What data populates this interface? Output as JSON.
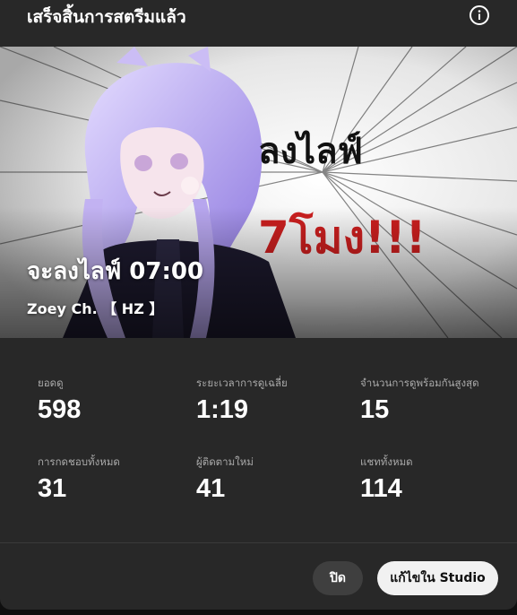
{
  "dialog": {
    "title": "เสร็จสิ้นการสตรีมแล้ว",
    "info_icon": "info-icon"
  },
  "thumbnail": {
    "title": "จะลงไลฟ์ 07:00",
    "channel": "Zoey Ch. 【 HZ 】",
    "art_text_line1": "ลงไลฟ์",
    "art_text_line2": "7โมง!!!",
    "colors": {
      "accent_red": "#cc1f1f",
      "hair": "#b9a6f0"
    }
  },
  "stats": [
    {
      "label": "ยอดดู",
      "value": "598"
    },
    {
      "label": "ระยะเวลาการดูเฉลี่ย",
      "value": "1:19"
    },
    {
      "label": "จำนวนการดูพร้อมกันสูงสุด",
      "value": "15"
    },
    {
      "label": "การกดชอบทั้งหมด",
      "value": "31"
    },
    {
      "label": "ผู้ติดตามใหม่",
      "value": "41"
    },
    {
      "label": "แชททั้งหมด",
      "value": "114"
    }
  ],
  "footer": {
    "close_label": "ปิด",
    "studio_label": "แก้ไขใน Studio"
  }
}
